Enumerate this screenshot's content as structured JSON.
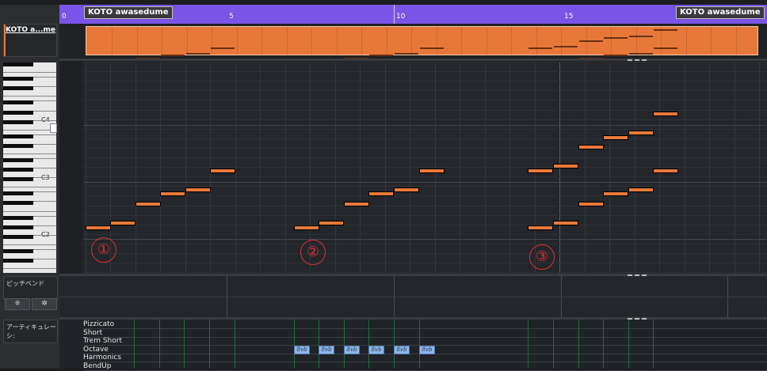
{
  "track": {
    "name": "KOTO a...me"
  },
  "ruler": {
    "labels": [
      "0",
      "5",
      "10",
      "15"
    ],
    "part_name_left": "KOTO awasedume",
    "part_name_right": "KOTO awasedume"
  },
  "piano": {
    "c_labels": [
      "C4",
      "C3",
      "C2"
    ]
  },
  "annotations": [
    "①",
    "②",
    "③"
  ],
  "lanes": {
    "pitchbend_label": "ピッチベンド",
    "articulation_label": "アーティキュレーシ:",
    "articulations": [
      "Pizzicato",
      "Short",
      "Trem Short",
      "Octave",
      "Harmonics",
      "BendUp"
    ]
  },
  "octave_marker_text": "8vb",
  "colors": {
    "ruler": "#7a54e6",
    "note": "#e8783a",
    "annotation": "#e03030",
    "octave_block": "#8fb6e8"
  }
}
